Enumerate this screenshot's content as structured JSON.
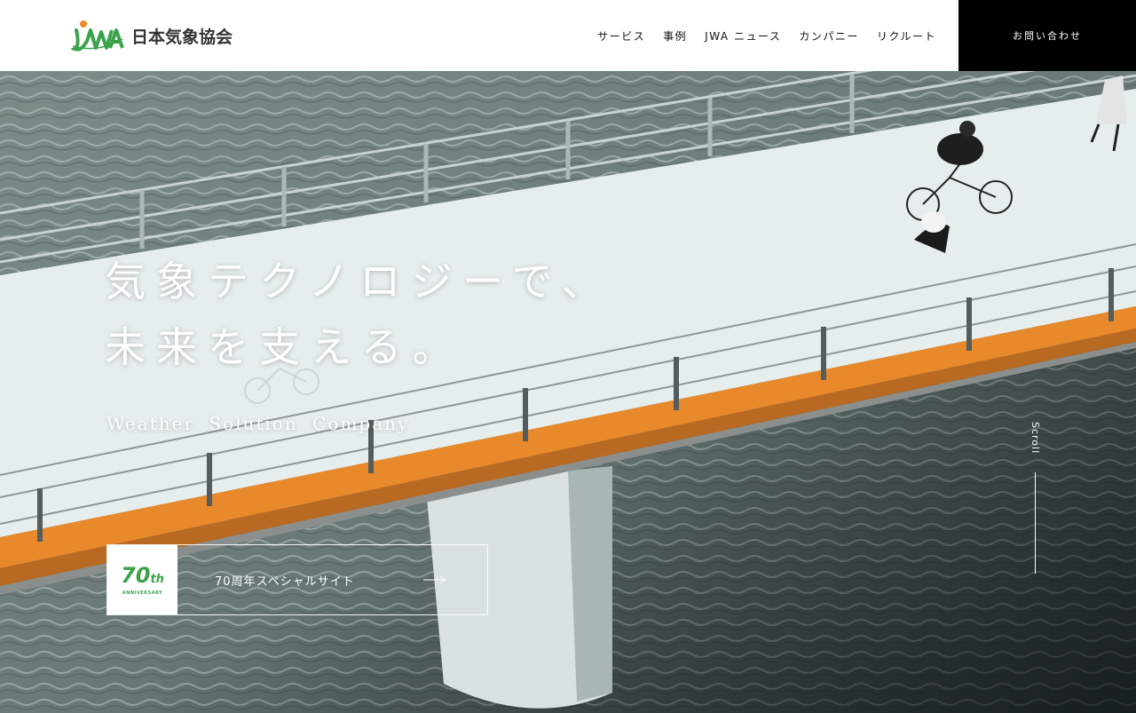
{
  "header": {
    "logo_mark": "JWA",
    "logo_text": "日本気象協会",
    "nav": [
      {
        "label": "サービス"
      },
      {
        "label": "事例"
      },
      {
        "label": "JWA ニュース"
      },
      {
        "label": "カンパニー"
      },
      {
        "label": "リクルート"
      }
    ],
    "contact_label": "お問い合わせ"
  },
  "hero": {
    "headline_line1": "気象テクノロジーで、",
    "headline_line2": "未来を支える。",
    "tagline": "Weather Solution Company",
    "anniversary": {
      "badge_number": "70",
      "badge_suffix": "th",
      "badge_sub": "ANNIVERSARY",
      "label": "70周年スペシャルサイト"
    },
    "scroll_label": "Scroll"
  },
  "colors": {
    "brand_green": "#3aa34a",
    "brand_orange": "#f08c2a",
    "contact_bg": "#000000"
  },
  "icons": [
    "jwa-logo-icon",
    "arrow-right-icon"
  ]
}
